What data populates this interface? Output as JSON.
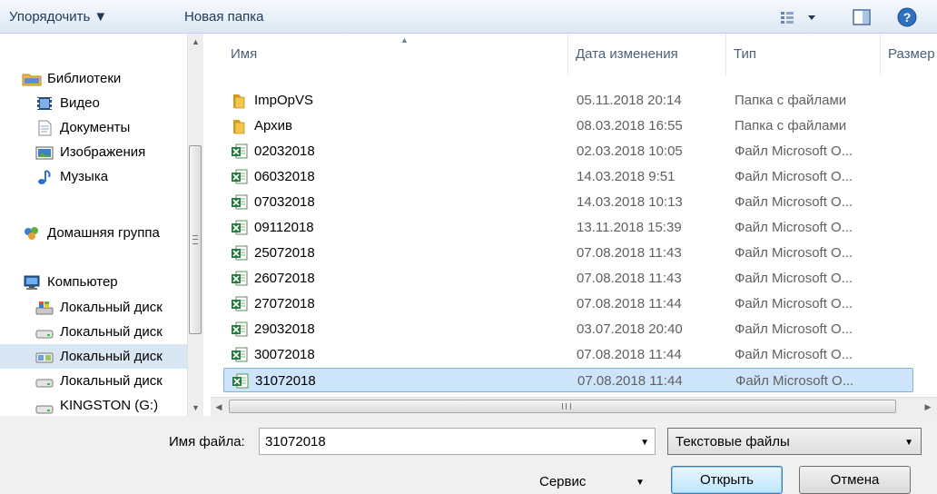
{
  "toolbar": {
    "organize_label": "Упорядочить ▼",
    "new_folder_label": "Новая папка"
  },
  "nav": {
    "items": [
      {
        "label": "Библиотеки",
        "icon": "libraries-icon",
        "level": 0
      },
      {
        "label": "Видео",
        "icon": "video-icon",
        "level": 1
      },
      {
        "label": "Документы",
        "icon": "documents-icon",
        "level": 1
      },
      {
        "label": "Изображения",
        "icon": "pictures-icon",
        "level": 1
      },
      {
        "label": "Музыка",
        "icon": "music-icon",
        "level": 1
      },
      {
        "label": "Домашняя группа",
        "icon": "homegroup-icon",
        "level": 0
      },
      {
        "label": "Компьютер",
        "icon": "computer-icon",
        "level": 0
      },
      {
        "label": "Локальный диск",
        "icon": "system-drive-icon",
        "level": 1
      },
      {
        "label": "Локальный диск",
        "icon": "drive-icon",
        "level": 1
      },
      {
        "label": "Локальный диск",
        "icon": "network-drive-icon",
        "level": 1,
        "selected": true
      },
      {
        "label": "Локальный диск",
        "icon": "drive-icon",
        "level": 1
      },
      {
        "label": "KINGSTON (G:)",
        "icon": "drive-icon",
        "level": 1
      }
    ]
  },
  "list": {
    "columns": [
      "Имя",
      "Дата изменения",
      "Тип",
      "Размер"
    ],
    "files": [
      {
        "name": "ImpOpVS",
        "date": "05.11.2018 20:14",
        "type": "Папка с файлами",
        "icon": "folder-icon"
      },
      {
        "name": "Архив",
        "date": "08.03.2018 16:55",
        "type": "Папка с файлами",
        "icon": "folder-icon"
      },
      {
        "name": "02032018",
        "date": "02.03.2018 10:05",
        "type": "Файл Microsoft O...",
        "icon": "excel-file-icon"
      },
      {
        "name": "06032018",
        "date": "14.03.2018 9:51",
        "type": "Файл Microsoft O...",
        "icon": "excel-file-icon"
      },
      {
        "name": "07032018",
        "date": "14.03.2018 10:13",
        "type": "Файл Microsoft O...",
        "icon": "excel-file-icon"
      },
      {
        "name": "09112018",
        "date": "13.11.2018 15:39",
        "type": "Файл Microsoft O...",
        "icon": "excel-file-icon"
      },
      {
        "name": "25072018",
        "date": "07.08.2018 11:43",
        "type": "Файл Microsoft O...",
        "icon": "excel-file-icon"
      },
      {
        "name": "26072018",
        "date": "07.08.2018 11:43",
        "type": "Файл Microsoft O...",
        "icon": "excel-file-icon"
      },
      {
        "name": "27072018",
        "date": "07.08.2018 11:44",
        "type": "Файл Microsoft O...",
        "icon": "excel-file-icon"
      },
      {
        "name": "29032018",
        "date": "03.07.2018 20:40",
        "type": "Файл Microsoft O...",
        "icon": "excel-file-icon"
      },
      {
        "name": "30072018",
        "date": "07.08.2018 11:44",
        "type": "Файл Microsoft O...",
        "icon": "excel-file-icon"
      },
      {
        "name": "31072018",
        "date": "07.08.2018 11:44",
        "type": "Файл Microsoft O...",
        "icon": "excel-file-icon",
        "selected": true
      }
    ]
  },
  "bottom": {
    "filename_label": "Имя файла:",
    "filename_value": "31072018",
    "filter_value": "Текстовые файлы",
    "service_label": "Сервис",
    "open_label": "Открыть",
    "cancel_label": "Отмена"
  },
  "colors": {
    "selection": "#cde4fb",
    "selection_border": "#7db1e6",
    "toolbar_text": "#1e395b"
  }
}
